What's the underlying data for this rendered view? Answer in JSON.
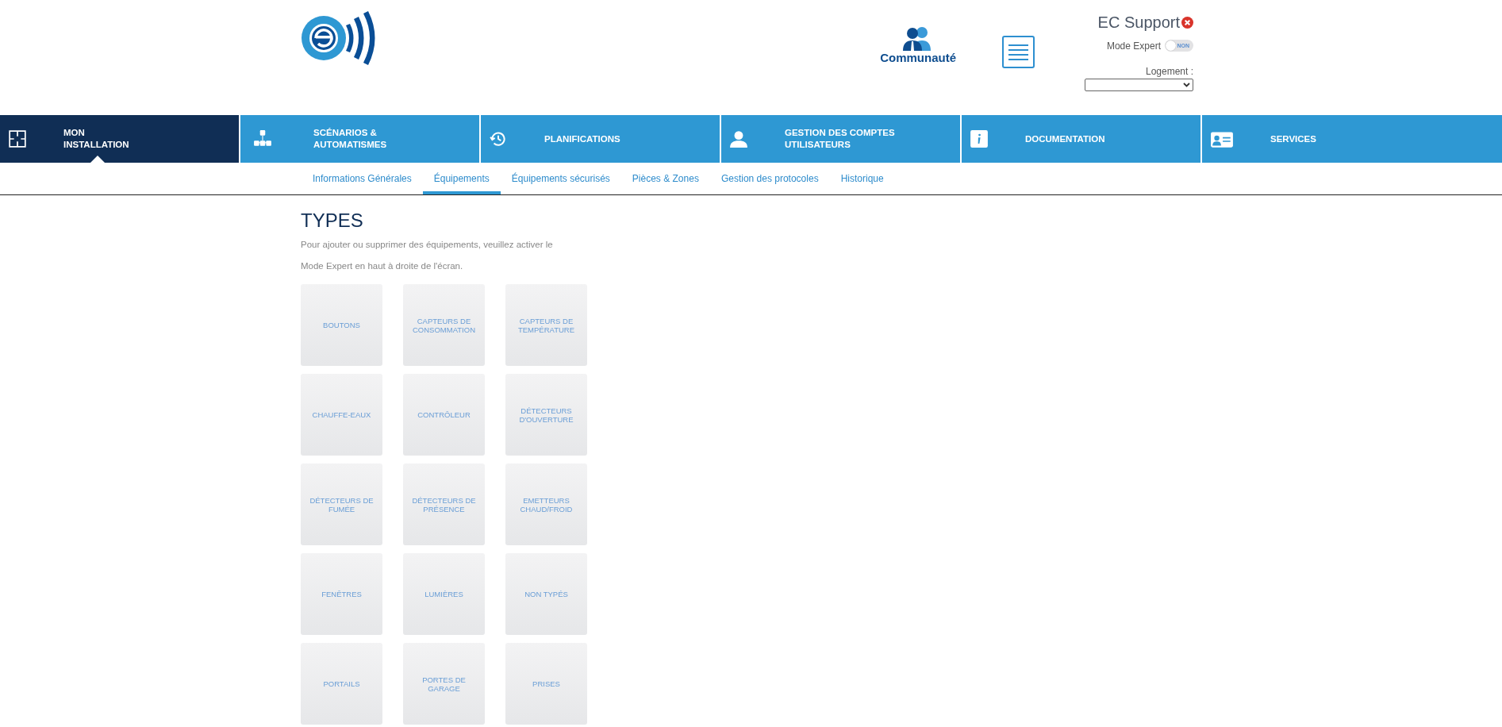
{
  "header": {
    "community_label": "Communauté",
    "user_name": "EC Support",
    "expert_mode": {
      "label": "Mode Expert",
      "on": false,
      "state_text": "NON"
    },
    "housing": {
      "label": "Logement :"
    }
  },
  "nav": [
    {
      "lines": [
        "MON",
        "INSTALLATION"
      ],
      "selected": true
    },
    {
      "lines": [
        "SCÉNARIOS &",
        "AUTOMATISMES"
      ],
      "selected": false
    },
    {
      "lines": [
        "PLANIFICATIONS"
      ],
      "selected": false
    },
    {
      "lines": [
        "GESTION DES COMPTES",
        "UTILISATEURS"
      ],
      "selected": false
    },
    {
      "lines": [
        "DOCUMENTATION"
      ],
      "selected": false
    },
    {
      "lines": [
        "SERVICES"
      ],
      "selected": false
    }
  ],
  "subnav": [
    {
      "label": "Informations Générales",
      "selected": false
    },
    {
      "label": "Équipements",
      "selected": true
    },
    {
      "label": "Équipements sécurisés",
      "selected": false
    },
    {
      "label": "Pièces & Zones",
      "selected": false
    },
    {
      "label": "Gestion des protocoles",
      "selected": false
    },
    {
      "label": "Historique",
      "selected": false
    }
  ],
  "content": {
    "title": "TYPES",
    "description": [
      "Pour ajouter ou supprimer des équipements, veuillez activer le",
      "Mode Expert en haut à droite de l'écran."
    ],
    "types": [
      "BOUTONS",
      "CAPTEURS DE CONSOMMATION",
      "CAPTEURS DE TEMPÉRATURE",
      "CHAUFFE-EAUX",
      "CONTRÔLEUR",
      "DÉTECTEURS D'OUVERTURE",
      "DÉTECTEURS DE FUMÉE",
      "DÉTECTEURS DE PRÉSENCE",
      "EMETTEURS CHAUD/FROID",
      "FENÊTRES",
      "LUMIÈRES",
      "NON TYPÉS",
      "PORTAILS",
      "PORTES DE GARAGE",
      "PRISES"
    ]
  }
}
